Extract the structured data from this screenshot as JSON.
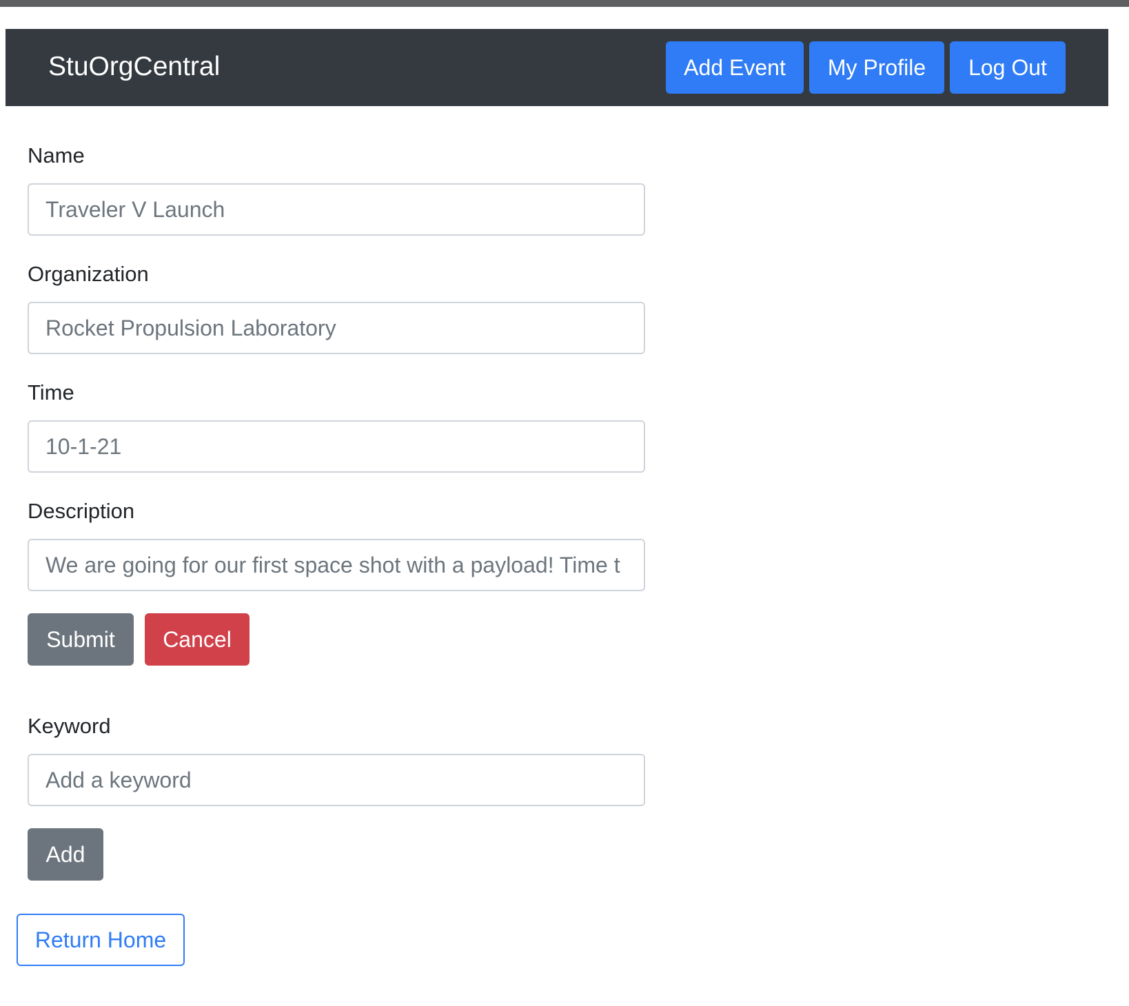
{
  "navbar": {
    "brand": "StuOrgCentral",
    "buttons": [
      "Add Event",
      "My Profile",
      "Log Out"
    ]
  },
  "form": {
    "name": {
      "label": "Name",
      "value": "Traveler V Launch"
    },
    "organization": {
      "label": "Organization",
      "value": "Rocket Propulsion Laboratory"
    },
    "time": {
      "label": "Time",
      "value": "10-1-21"
    },
    "description": {
      "label": "Description",
      "value": "We are going for our first space shot with a payload! Time t"
    },
    "submit_label": "Submit",
    "cancel_label": "Cancel"
  },
  "keyword": {
    "label": "Keyword",
    "placeholder": "Add a keyword",
    "add_label": "Add"
  },
  "return_home_label": "Return Home",
  "colors": {
    "navbar_bg": "#343a40",
    "primary": "#2f7cf6",
    "secondary": "#6c757d",
    "danger": "#d0414a"
  }
}
